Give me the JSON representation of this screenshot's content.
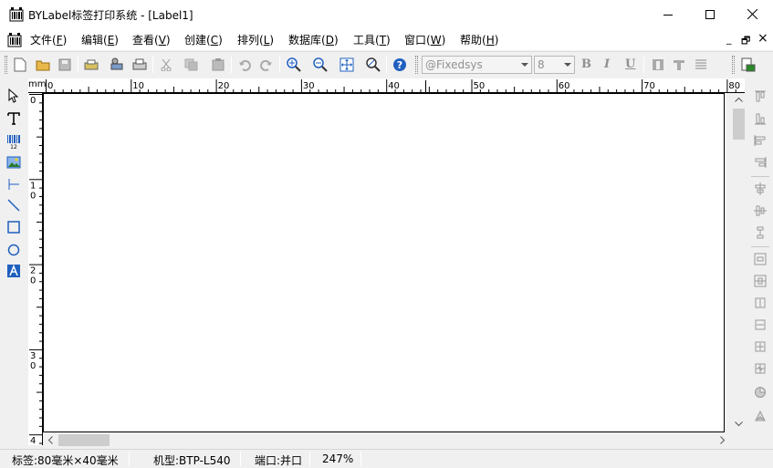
{
  "window": {
    "title": "BYLabel标签打印系统 - [Label1]",
    "app_icon": "barcode-icon",
    "controls": [
      "minimize-icon",
      "maximize-icon",
      "close-icon"
    ]
  },
  "menu": {
    "items": [
      {
        "label": "文件(",
        "key": "F",
        "end": ")"
      },
      {
        "label": "编辑(",
        "key": "E",
        "end": ")"
      },
      {
        "label": "查看(",
        "key": "V",
        "end": ")"
      },
      {
        "label": "创建(",
        "key": "C",
        "end": ")"
      },
      {
        "label": "排列(",
        "key": "L",
        "end": ")"
      },
      {
        "label": "数据库(",
        "key": "D",
        "end": ")"
      },
      {
        "label": "工具(",
        "key": "T",
        "end": ")"
      },
      {
        "label": "窗口(",
        "key": "W",
        "end": ")"
      },
      {
        "label": "帮助(",
        "key": "H",
        "end": ")"
      }
    ],
    "mdi_controls": [
      "_",
      "🗗",
      "×"
    ]
  },
  "toolbar": {
    "font_name": "@Fixedsys",
    "font_size": "8",
    "bold": "B",
    "italic": "I",
    "underline": "U"
  },
  "ruler": {
    "unit": "mm",
    "h_labels": [
      "0",
      "10",
      "20",
      "30",
      "40",
      "50",
      "60",
      "70",
      "80"
    ],
    "v_labels": [
      [
        "0"
      ],
      [
        "1",
        "0"
      ],
      [
        "2",
        "0"
      ],
      [
        "3",
        "0"
      ],
      [
        "4"
      ]
    ]
  },
  "status": {
    "label_size": "标签:80毫米×40毫米",
    "model": "机型:BTP-L540",
    "port": "端口:并口",
    "zoom": "247%"
  },
  "colors": {
    "accent_blue": "#1f5fbf",
    "disabled_gray": "#909090"
  }
}
